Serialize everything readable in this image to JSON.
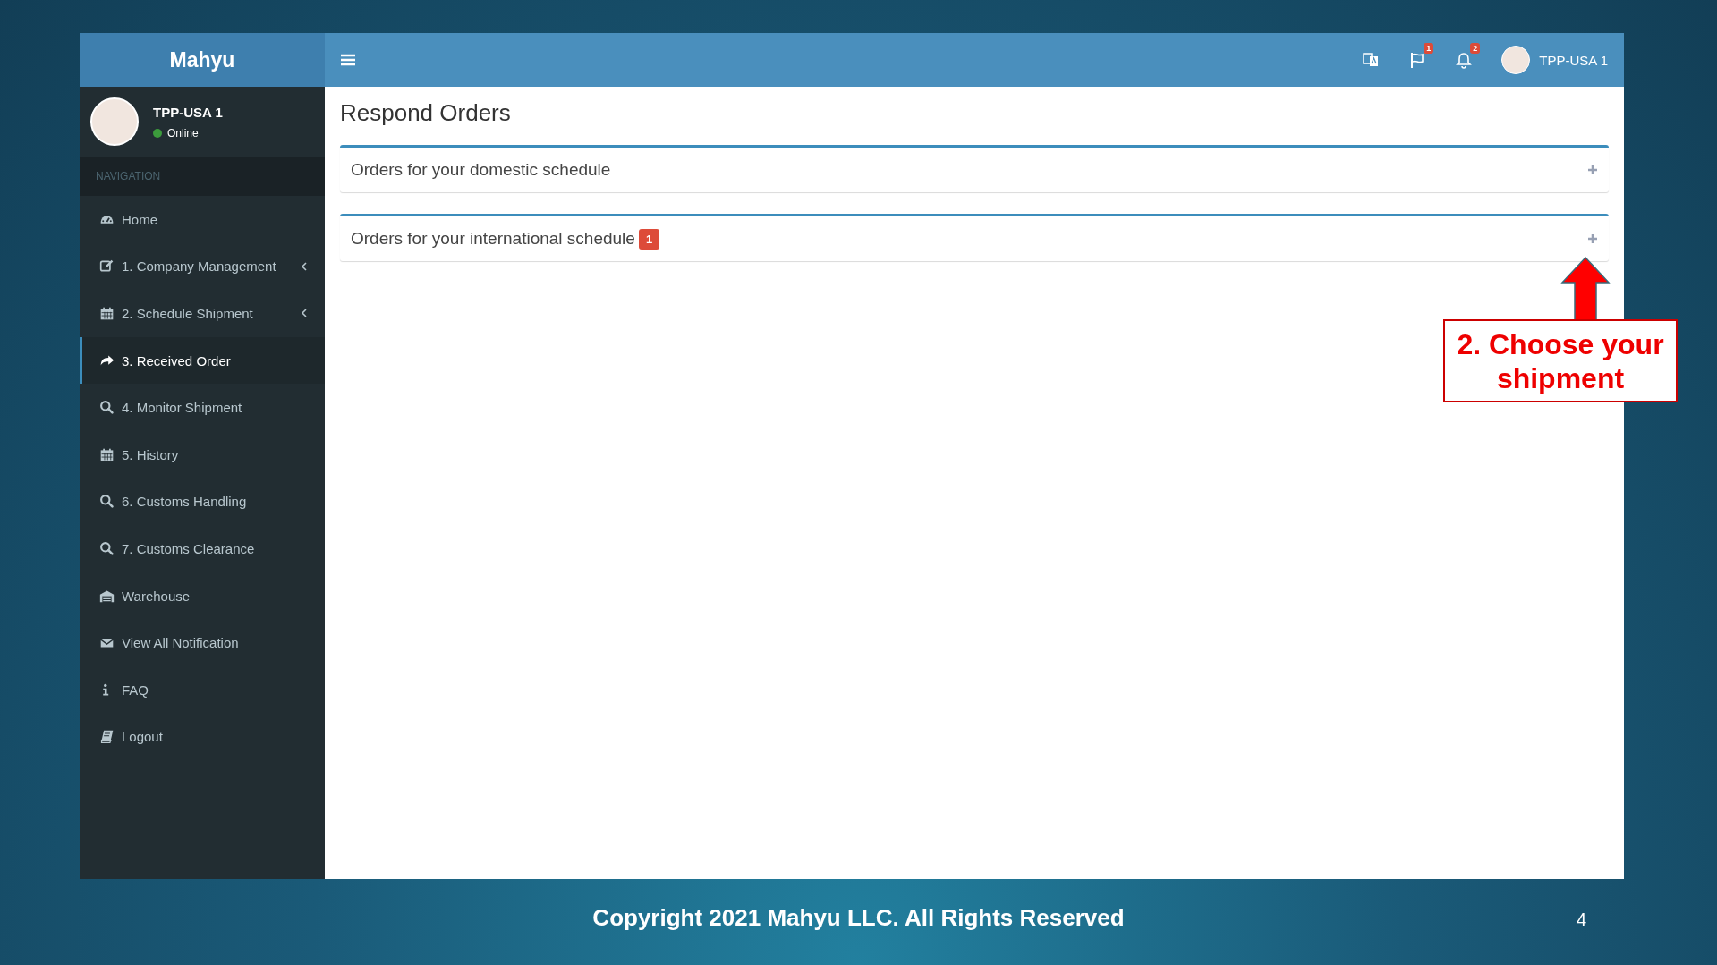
{
  "app": {
    "brand": "Mahyu",
    "topbar": {
      "flag_badge": "1",
      "bell_badge": "2",
      "user": "TPP-USA 1"
    },
    "sidebar": {
      "user": {
        "name": "TPP-USA 1",
        "status": "Online"
      },
      "header": "NAVIGATION",
      "items": [
        {
          "label": "Home",
          "selected": false,
          "submenu": false
        },
        {
          "label": "1. Company Management",
          "selected": false,
          "submenu": true
        },
        {
          "label": "2. Schedule Shipment",
          "selected": false,
          "submenu": true
        },
        {
          "label": "3. Received Order",
          "selected": true,
          "submenu": false
        },
        {
          "label": "4. Monitor Shipment",
          "selected": false,
          "submenu": false
        },
        {
          "label": "5. History",
          "selected": false,
          "submenu": false
        },
        {
          "label": "6. Customs Handling",
          "selected": false,
          "submenu": false
        },
        {
          "label": "7. Customs Clearance",
          "selected": false,
          "submenu": false
        },
        {
          "label": "Warehouse",
          "selected": false,
          "submenu": false
        },
        {
          "label": "View All Notification",
          "selected": false,
          "submenu": false
        },
        {
          "label": "FAQ",
          "selected": false,
          "submenu": false
        },
        {
          "label": "Logout",
          "selected": false,
          "submenu": false
        }
      ]
    },
    "page_title": "Respond Orders",
    "panels": [
      {
        "title": "Orders for your domestic schedule"
      },
      {
        "title": "Orders for your international schedule",
        "badge": "1"
      }
    ]
  },
  "callout": "2. Choose your shipment",
  "footer": {
    "copyright": "Copyright 2021 Mahyu LLC. All Rights Reserved",
    "page_number": "4"
  }
}
